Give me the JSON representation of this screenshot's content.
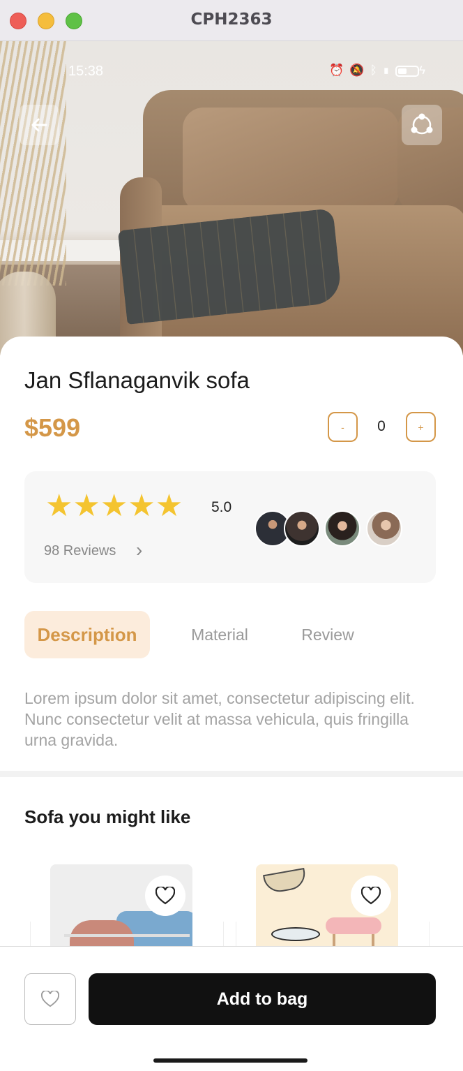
{
  "window": {
    "title": "CPH2363"
  },
  "status_bar": {
    "time": "15:38"
  },
  "product": {
    "name": "Jan Sflanaganvik sofa",
    "price": "$599",
    "quantity": "0",
    "minus_label": "-",
    "plus_label": "+"
  },
  "rating": {
    "stars": 5,
    "value": "5.0",
    "reviews_label": "98 Reviews",
    "star_glyphs": "★★★★★"
  },
  "tabs": [
    {
      "label": "Description",
      "active": true
    },
    {
      "label": "Material",
      "active": false
    },
    {
      "label": "Review",
      "active": false
    }
  ],
  "description": "Lorem ipsum dolor sit amet, consectetur adipiscing elit. Nunc consectetur velit at massa vehicula, quis fringilla urna gravida.",
  "recommendations": {
    "title": "Sofa you might like",
    "items": [
      {
        "icon": "heart-icon"
      },
      {
        "icon": "heart-icon"
      }
    ]
  },
  "actions": {
    "add_to_bag": "Add to bag",
    "wishlist_icon": "heart-icon"
  },
  "colors": {
    "accent": "#d49748",
    "accent_bg": "#fcecdc",
    "primary_button": "#111111",
    "star": "#f4c430"
  }
}
